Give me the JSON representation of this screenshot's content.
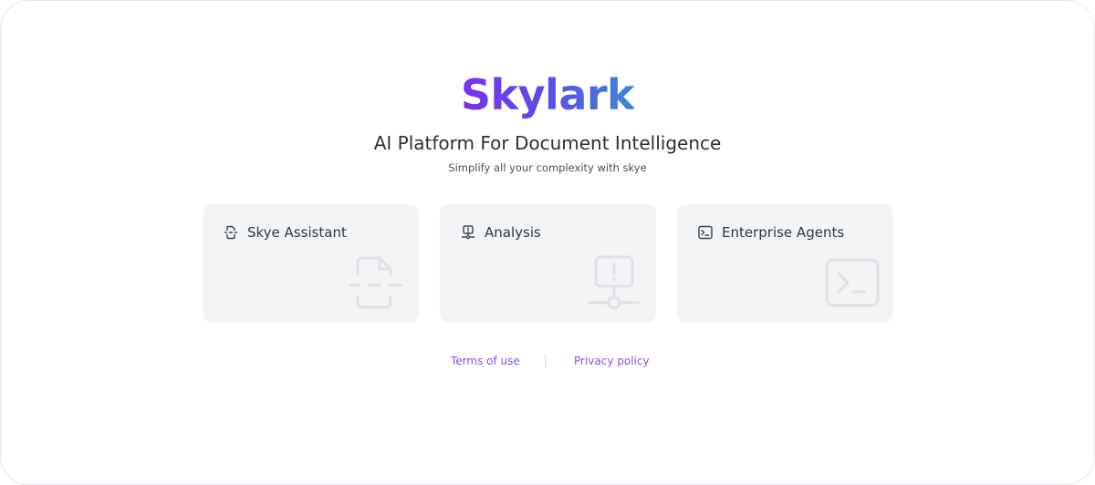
{
  "brand": {
    "logo_text": "Skylark",
    "gradient_start": "#7b2ff2",
    "gradient_end": "#3f86d6"
  },
  "hero": {
    "headline": "AI Platform For Document Intelligence",
    "tagline": "Simplify all your complexity with skye"
  },
  "cards": [
    {
      "label": "Skye Assistant",
      "icon": "document-scan-icon"
    },
    {
      "label": "Analysis",
      "icon": "monitor-alert-icon"
    },
    {
      "label": "Enterprise Agents",
      "icon": "terminal-icon"
    }
  ],
  "footer": {
    "terms_label": "Terms of use",
    "privacy_label": "Privacy policy",
    "link_color": "#8b4fe6"
  }
}
